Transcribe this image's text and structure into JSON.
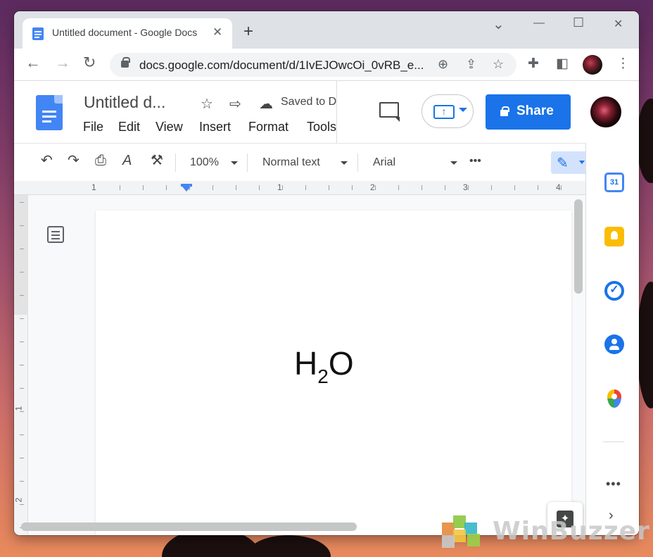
{
  "browser": {
    "tab_title": "Untitled document - Google Docs",
    "tab_close": "✕",
    "new_tab": "+",
    "url": "docs.google.com/document/d/1IvEJOwcOi_0vRB_e...",
    "window_controls": {
      "chevron": "⌄",
      "minimize": "—",
      "maximize": "☐",
      "close": "✕"
    }
  },
  "docs": {
    "title": "Untitled d...",
    "saved_status": "Saved to Drive",
    "menu": [
      "File",
      "Edit",
      "View",
      "Insert",
      "Format",
      "Tools"
    ],
    "share_label": "Share"
  },
  "toolbar": {
    "zoom": "100%",
    "style": "Normal text",
    "font": "Arial",
    "more": "•••"
  },
  "ruler": {
    "horizontal": [
      "1",
      "1",
      "2",
      "3",
      "4"
    ],
    "vertical": [
      "1",
      "1",
      "2"
    ]
  },
  "document": {
    "formula_main": "H",
    "formula_sub": "2",
    "formula_end": "O"
  },
  "side_panel": {
    "calendar_day": "31",
    "more": "•••"
  },
  "watermark": {
    "text": "WinBuzzer"
  },
  "colors": {
    "accent": "#1a73e8",
    "docs_blue": "#4285f4",
    "keep_yellow": "#fbbc04"
  }
}
